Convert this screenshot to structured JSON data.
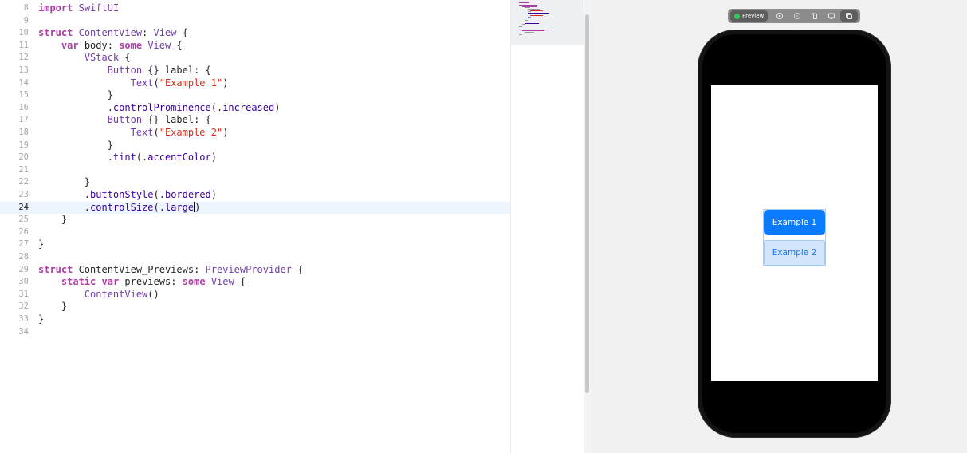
{
  "editor": {
    "current_line": "24",
    "lines": [
      {
        "n": "8",
        "text": "import SwiftUI"
      },
      {
        "n": "9",
        "text": ""
      },
      {
        "n": "10",
        "text": "struct ContentView: View {"
      },
      {
        "n": "11",
        "text": "    var body: some View {"
      },
      {
        "n": "12",
        "text": "        VStack {"
      },
      {
        "n": "13",
        "text": "            Button {} label: {"
      },
      {
        "n": "14",
        "text": "                Text(\"Example 1\")"
      },
      {
        "n": "15",
        "text": "            }"
      },
      {
        "n": "16",
        "text": "            .controlProminence(.increased)"
      },
      {
        "n": "17",
        "text": "            Button {} label: {"
      },
      {
        "n": "18",
        "text": "                Text(\"Example 2\")"
      },
      {
        "n": "19",
        "text": "            }"
      },
      {
        "n": "20",
        "text": "            .tint(.accentColor)"
      },
      {
        "n": "21",
        "text": ""
      },
      {
        "n": "22",
        "text": "        }"
      },
      {
        "n": "23",
        "text": "        .buttonStyle(.bordered)"
      },
      {
        "n": "24",
        "text": "        .controlSize(.large)"
      },
      {
        "n": "25",
        "text": "    }"
      },
      {
        "n": "26",
        "text": ""
      },
      {
        "n": "27",
        "text": "}"
      },
      {
        "n": "28",
        "text": ""
      },
      {
        "n": "29",
        "text": "struct ContentView_Previews: PreviewProvider {"
      },
      {
        "n": "30",
        "text": "    static var previews: some View {"
      },
      {
        "n": "31",
        "text": "        ContentView()"
      },
      {
        "n": "32",
        "text": "    }"
      },
      {
        "n": "33",
        "text": "}"
      },
      {
        "n": "34",
        "text": ""
      }
    ]
  },
  "syntax": {
    "keywords": [
      "import",
      "struct",
      "var",
      "some",
      "static"
    ],
    "types": [
      "SwiftUI",
      "View",
      "VStack",
      "Button",
      "Text",
      "PreviewProvider",
      "ContentView"
    ],
    "colors": {
      "keyword": "#ad3da4",
      "type": "#703daa",
      "member": "#3900a0",
      "string": "#d12f1b",
      "plain": "#262626"
    }
  },
  "preview_toolbar": {
    "live_label": "Preview",
    "live_color": "#35c759",
    "buttons": [
      "inspect-icon",
      "variants-icon",
      "rotate-icon",
      "device-icon",
      "duplicate-icon"
    ]
  },
  "preview": {
    "button1_label": "Example 1",
    "button2_label": "Example 2",
    "accent_color": "#0a7bff"
  }
}
